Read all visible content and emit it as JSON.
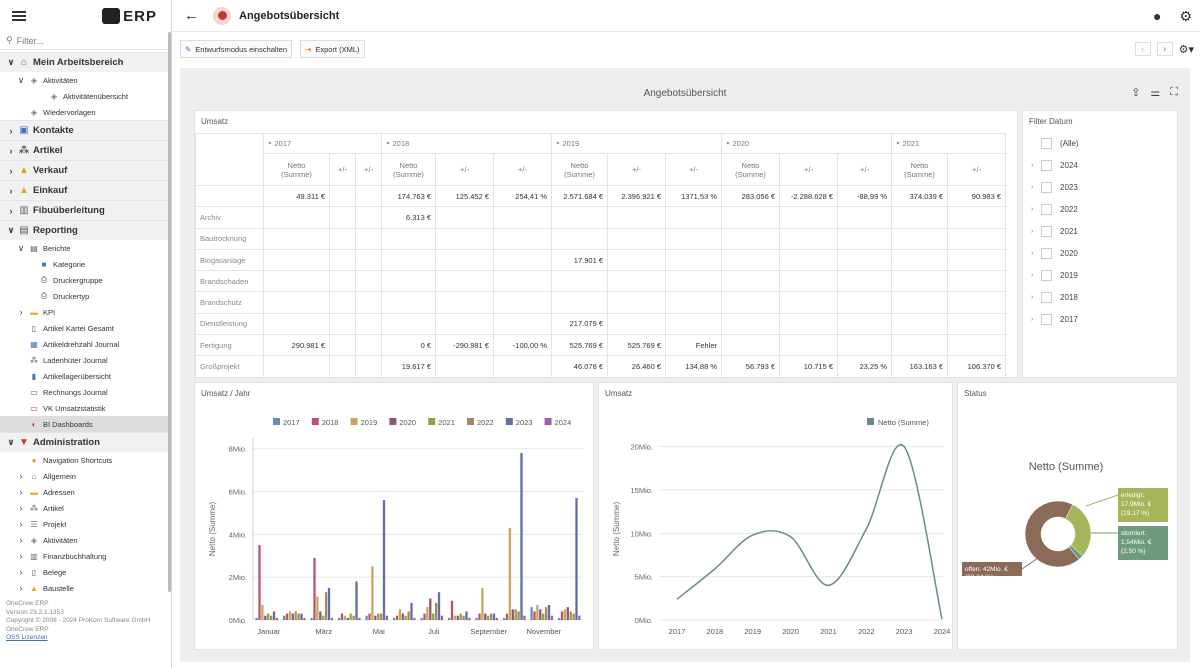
{
  "app": {
    "logo_text": "ERP"
  },
  "sidebar": {
    "filter_placeholder": "Filter...",
    "items": [
      {
        "label": "Mein Arbeitsbereich",
        "level": 0,
        "chev": "∨",
        "icon": "home-icon",
        "glyph": "⌂",
        "color": "#2f6fc4"
      },
      {
        "label": "Aktivitäten",
        "level": 1,
        "chev": "∨",
        "icon": "activities-icon",
        "glyph": "◈",
        "color": "#777"
      },
      {
        "label": "Aktivitätenübersicht",
        "level": 3,
        "chev": "",
        "icon": "activities-icon",
        "glyph": "◈",
        "color": "#777"
      },
      {
        "label": "Wiedervorlagen",
        "level": 1,
        "chev": "",
        "icon": "followup-icon",
        "glyph": "◈",
        "color": "#777"
      },
      {
        "label": "Kontakte",
        "level": 0,
        "chev": "›",
        "icon": "contacts-icon",
        "glyph": "▣",
        "color": "#3f73c9"
      },
      {
        "label": "Artikel",
        "level": 0,
        "chev": "›",
        "icon": "articles-icon",
        "glyph": "⁂",
        "color": "#555"
      },
      {
        "label": "Verkauf",
        "level": 0,
        "chev": "›",
        "icon": "sales-icon",
        "glyph": "▲",
        "color": "#e0a020"
      },
      {
        "label": "Einkauf",
        "level": 0,
        "chev": "›",
        "icon": "purchase-icon",
        "glyph": "▲",
        "color": "#e0a020"
      },
      {
        "label": "Fibuüberleitung",
        "level": 0,
        "chev": "›",
        "icon": "bank-icon",
        "glyph": "▥",
        "color": "#666"
      },
      {
        "label": "Reporting",
        "level": 0,
        "chev": "∨",
        "icon": "report-icon",
        "glyph": "▤",
        "color": "#555"
      },
      {
        "label": "Berichte",
        "level": 1,
        "chev": "∨",
        "icon": "report-icon",
        "glyph": "▤",
        "color": "#555"
      },
      {
        "label": "Kategorie",
        "level": 2,
        "chev": "",
        "icon": "category-icon",
        "glyph": "■",
        "color": "#3f73c9"
      },
      {
        "label": "Druckergruppe",
        "level": 2,
        "chev": "",
        "icon": "printer-icon",
        "glyph": "⎙",
        "color": "#555"
      },
      {
        "label": "Druckertyp",
        "level": 2,
        "chev": "",
        "icon": "printer-icon",
        "glyph": "⎙",
        "color": "#555"
      },
      {
        "label": "KPI",
        "level": 1,
        "chev": "›",
        "icon": "folder-icon",
        "glyph": "▬",
        "color": "#e6b33d"
      },
      {
        "label": "Artikel Kartei Gesamt",
        "level": 1,
        "chev": "",
        "icon": "file-icon",
        "glyph": "▯",
        "color": "#555"
      },
      {
        "label": "Artikeldrehzahl Journal",
        "level": 1,
        "chev": "",
        "icon": "chart-icon",
        "glyph": "▦",
        "color": "#3f73c9"
      },
      {
        "label": "Ladenhüter Journal",
        "level": 1,
        "chev": "",
        "icon": "articles-icon",
        "glyph": "⁂",
        "color": "#555"
      },
      {
        "label": "Artikellagerübersicht",
        "level": 1,
        "chev": "",
        "icon": "stock-icon",
        "glyph": "▮",
        "color": "#3f73c9"
      },
      {
        "label": "Rechnungs Journal",
        "level": 1,
        "chev": "",
        "icon": "invoice-icon",
        "glyph": "▭",
        "color": "#555"
      },
      {
        "label": "VK Umsatzstatistik",
        "level": 1,
        "chev": "",
        "icon": "stats-icon",
        "glyph": "▭",
        "color": "#c0392b"
      },
      {
        "label": "BI Dashboards",
        "level": 1,
        "chev": "",
        "icon": "dashboard-icon",
        "glyph": "◐",
        "color": "#c0392b",
        "selected": true
      },
      {
        "label": "Administration",
        "level": 0,
        "chev": "∨",
        "icon": "admin-icon",
        "glyph": "▼",
        "color": "#c0392b"
      },
      {
        "label": "Navigation Shortcuts",
        "level": 1,
        "chev": "",
        "icon": "shortcut-icon",
        "glyph": "●",
        "color": "#e0a020"
      },
      {
        "label": "Allgemein",
        "level": 1,
        "chev": "›",
        "icon": "home-icon",
        "glyph": "⌂",
        "color": "#2f6fc4"
      },
      {
        "label": "Adressen",
        "level": 1,
        "chev": "›",
        "icon": "folder-icon",
        "glyph": "▬",
        "color": "#e6b33d"
      },
      {
        "label": "Artikel",
        "level": 1,
        "chev": "›",
        "icon": "articles-icon",
        "glyph": "⁂",
        "color": "#555"
      },
      {
        "label": "Projekt",
        "level": 1,
        "chev": "›",
        "icon": "project-icon",
        "glyph": "☰",
        "color": "#777"
      },
      {
        "label": "Aktivitäten",
        "level": 1,
        "chev": "›",
        "icon": "activities-icon",
        "glyph": "◈",
        "color": "#777"
      },
      {
        "label": "Finanzbuchhaltung",
        "level": 1,
        "chev": "›",
        "icon": "bank-icon",
        "glyph": "▥",
        "color": "#666"
      },
      {
        "label": "Belege",
        "level": 1,
        "chev": "›",
        "icon": "document-icon",
        "glyph": "▯",
        "color": "#555"
      },
      {
        "label": "Baustelle",
        "level": 1,
        "chev": "›",
        "icon": "construction-icon",
        "glyph": "▲",
        "color": "#e0a020"
      }
    ],
    "footer": {
      "line1": "OneCrew ERP",
      "line2": "Version 23.2.1.1353",
      "line3": "Copyright © 2008 - 2024 ProKom Software GmbH",
      "line4": "OneCrew ERP",
      "link": "OSS Lizenzen"
    }
  },
  "header": {
    "title": "Angebotsübersicht"
  },
  "toolbar": {
    "draft_label": "Entwurfsmodus einschalten",
    "export_label": "Export (XML)"
  },
  "dashboard": {
    "title": "Angebotsübersicht"
  },
  "pivot": {
    "title": "Umsatz",
    "years": [
      {
        "label": "2017",
        "cols": 3
      },
      {
        "label": "2018",
        "cols": 3
      },
      {
        "label": "2019",
        "cols": 3
      },
      {
        "label": "2020",
        "cols": 3
      },
      {
        "label": "2021",
        "cols": 2
      }
    ],
    "measure_headers": [
      "Netto\n(Summe)",
      "+/-",
      "+/-",
      "Netto\n(Summe)",
      "+/-",
      "+/-",
      "Netto\n(Summe)",
      "+/-",
      "+/-",
      "Netto\n(Summe)",
      "+/-",
      "+/-",
      "Netto\n(Summe)",
      "+/-"
    ],
    "rows": [
      {
        "label": "",
        "cells": [
          "49.311 €",
          "",
          "",
          "174.763 €",
          "125.452 €",
          "254,41 %",
          "2.571.684 €",
          "2.396.921 €",
          "1371,53 %",
          "283.056 €",
          "-2.288.628 €",
          "-88,99 %",
          "374.039 €",
          "90.983 €"
        ]
      },
      {
        "label": "Archiv",
        "cells": [
          "",
          "",
          "",
          "6.313 €",
          "",
          "",
          "",
          "",
          "",
          "",
          "",
          "",
          "",
          ""
        ]
      },
      {
        "label": "Bautrocknung",
        "cells": [
          "",
          "",
          "",
          "",
          "",
          "",
          "",
          "",
          "",
          "",
          "",
          "",
          "",
          ""
        ]
      },
      {
        "label": "Biogasanlage",
        "cells": [
          "",
          "",
          "",
          "",
          "",
          "",
          "17.901 €",
          "",
          "",
          "",
          "",
          "",
          "",
          ""
        ]
      },
      {
        "label": "Brandschaden",
        "cells": [
          "",
          "",
          "",
          "",
          "",
          "",
          "",
          "",
          "",
          "",
          "",
          "",
          "",
          ""
        ]
      },
      {
        "label": "Brandschutz",
        "cells": [
          "",
          "",
          "",
          "",
          "",
          "",
          "",
          "",
          "",
          "",
          "",
          "",
          "",
          ""
        ]
      },
      {
        "label": "Dienstleistung",
        "cells": [
          "",
          "",
          "",
          "",
          "",
          "",
          "217.079 €",
          "",
          "",
          "",
          "",
          "",
          "",
          ""
        ]
      },
      {
        "label": "Fertigung",
        "cells": [
          "290.981 €",
          "",
          "",
          "0 €",
          "-290.981 €",
          "-100,00 %",
          "525.769 €",
          "525.769 €",
          "Fehler",
          "",
          "",
          "",
          "",
          ""
        ]
      },
      {
        "label": "Großprojekt",
        "cells": [
          "",
          "",
          "",
          "19.617 €",
          "",
          "",
          "46.078 €",
          "26.460 €",
          "134,88 %",
          "56.793 €",
          "10.715 €",
          "23,25 %",
          "163.163 €",
          "106.370 €"
        ]
      }
    ]
  },
  "filter": {
    "title": "Filter Datum",
    "items": [
      "(Alle)",
      "2024",
      "2023",
      "2022",
      "2021",
      "2020",
      "2019",
      "2018",
      "2017"
    ]
  },
  "chart_data": [
    {
      "type": "bar",
      "title": "Umsatz / Jahr",
      "ylabel": "Netto (Summe)",
      "ylim": [
        0,
        8.5
      ],
      "yticks": [
        "0Mio.",
        "2Mio.",
        "4Mio.",
        "6Mio.",
        "8Mio."
      ],
      "ytick_values": [
        0,
        2,
        4,
        6,
        8
      ],
      "categories": [
        "Januar",
        "Februar",
        "März",
        "April",
        "Mai",
        "Juni",
        "Juli",
        "August",
        "September",
        "Oktober",
        "November",
        "Dezember"
      ],
      "xtick_labels": [
        "Januar",
        "",
        "März",
        "",
        "Mai",
        "",
        "Juli",
        "",
        "September",
        "",
        "November",
        ""
      ],
      "legend_position": "top",
      "series": [
        {
          "name": "2017",
          "color": "#6a8caf",
          "values": [
            0.1,
            0.2,
            0.1,
            0.1,
            0.2,
            0.1,
            0.1,
            0.1,
            0.1,
            0.1,
            0.6,
            0.1
          ]
        },
        {
          "name": "2018",
          "color": "#b5566a",
          "values": [
            3.5,
            0.3,
            2.9,
            0.3,
            0.3,
            0.2,
            0.3,
            0.9,
            0.3,
            0.3,
            0.4,
            0.4
          ]
        },
        {
          "name": "2019",
          "color": "#c8a560",
          "values": [
            0.7,
            0.4,
            1.1,
            0.2,
            2.5,
            0.5,
            0.6,
            0.2,
            1.5,
            4.3,
            0.7,
            0.5
          ]
        },
        {
          "name": "2020",
          "color": "#8c5a70",
          "values": [
            0.2,
            0.3,
            0.4,
            0.1,
            0.2,
            0.3,
            1.0,
            0.2,
            0.3,
            0.5,
            0.5,
            0.6
          ]
        },
        {
          "name": "2021",
          "color": "#8fa24a",
          "values": [
            0.3,
            0.4,
            0.2,
            0.3,
            0.3,
            0.2,
            0.3,
            0.3,
            0.2,
            0.5,
            0.3,
            0.4
          ]
        },
        {
          "name": "2022",
          "color": "#a58a58",
          "values": [
            0.2,
            0.3,
            1.3,
            0.2,
            0.3,
            0.4,
            0.8,
            0.2,
            0.3,
            0.4,
            0.6,
            0.3
          ]
        },
        {
          "name": "2023",
          "color": "#5f6ea8",
          "values": [
            0.4,
            0.3,
            1.5,
            1.8,
            5.6,
            0.8,
            1.3,
            0.4,
            0.3,
            7.8,
            0.7,
            5.7
          ]
        },
        {
          "name": "2024",
          "color": "#a05cb0",
          "values": [
            0.1,
            0.1,
            0.1,
            0.1,
            0.2,
            0.1,
            0.2,
            0.1,
            0.1,
            0.2,
            0.2,
            0.2
          ]
        }
      ]
    },
    {
      "type": "line",
      "title": "Umsatz",
      "ylabel": "Netto (Summe)",
      "ylim": [
        0,
        21
      ],
      "yticks": [
        "0Mio.",
        "5Mio.",
        "10Mio.",
        "15Mio.",
        "20Mio."
      ],
      "ytick_values": [
        0,
        5,
        10,
        15,
        20
      ],
      "x": [
        "2017",
        "2018",
        "2019",
        "2020",
        "2021",
        "2022",
        "2023",
        "2024"
      ],
      "legend_position": "top-right",
      "series": [
        {
          "name": "Netto (Summe)",
          "color": "#6a8a90",
          "values": [
            2.4,
            5.9,
            9.8,
            9.6,
            4.0,
            10.5,
            20.0,
            0.1
          ]
        }
      ]
    },
    {
      "type": "pie",
      "title": "Status",
      "subtitle": "Netto (Summe)",
      "series": [
        {
          "name": "offen",
          "label": "offen: 42Mio. €",
          "pct_label": "(68,34 %)",
          "value": 68.34,
          "color": "#8b6a58"
        },
        {
          "name": "erledigt",
          "label": "erledigt:",
          "label2": "17,9Mio. €",
          "pct_label": "(29,17 %)",
          "value": 29.17,
          "color": "#a5b55a"
        },
        {
          "name": "storniert",
          "label": "storniert:",
          "label2": "1,54Mio. €",
          "pct_label": "(2,50 %)",
          "value": 2.5,
          "color": "#6e9a7e"
        }
      ]
    }
  ]
}
